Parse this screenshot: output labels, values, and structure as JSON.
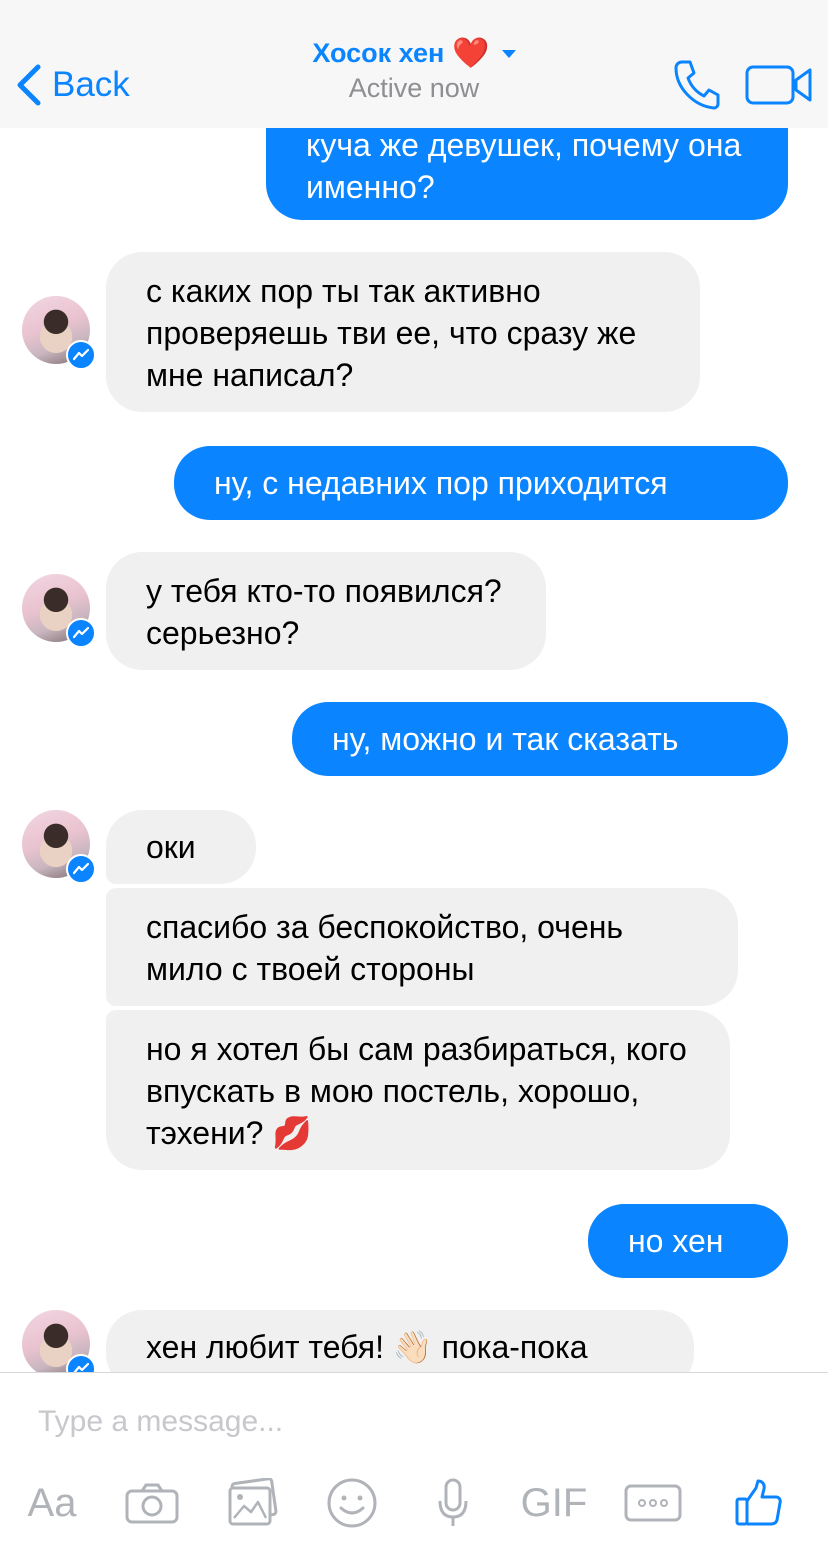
{
  "header": {
    "back_label": "Back",
    "contact_name": "Хосок хен",
    "heart": "❤️",
    "status": "Active now"
  },
  "messages": [
    {
      "from": "me",
      "text": "куча же девушек, почему она именно?"
    },
    {
      "from": "them",
      "text": "с каких пор ты так активно проверяешь тви ее, что сразу же мне написал?"
    },
    {
      "from": "me",
      "text": "ну, с недавних пор приходится"
    },
    {
      "from": "them",
      "text": "у тебя кто-то появился? серьезно?"
    },
    {
      "from": "me",
      "text": "ну, можно и так сказать"
    },
    {
      "from": "them",
      "text": "оки"
    },
    {
      "from": "them",
      "text": "спасибо за беспокойство, очень мило с твоей стороны"
    },
    {
      "from": "them",
      "text": "но я хотел бы сам разбираться, кого впускать в мою постель, хорошо, тэхени? 💋"
    },
    {
      "from": "me",
      "text": "но хен"
    },
    {
      "from": "them",
      "text": "хен любит тебя! 👋🏻 пока-пока"
    }
  ],
  "composer": {
    "placeholder": "Type a message...",
    "aa_label": "Aa",
    "gif_label": "GIF"
  },
  "colors": {
    "accent": "#0a84ff",
    "received_bubble": "#f1f0f0",
    "heart": "#e0202a"
  },
  "icons": [
    "chevron-left-icon",
    "phone-icon",
    "video-camera-icon",
    "messenger-badge-icon",
    "camera-icon",
    "gallery-icon",
    "emoji-icon",
    "microphone-icon",
    "more-icon",
    "thumbs-up-icon"
  ]
}
